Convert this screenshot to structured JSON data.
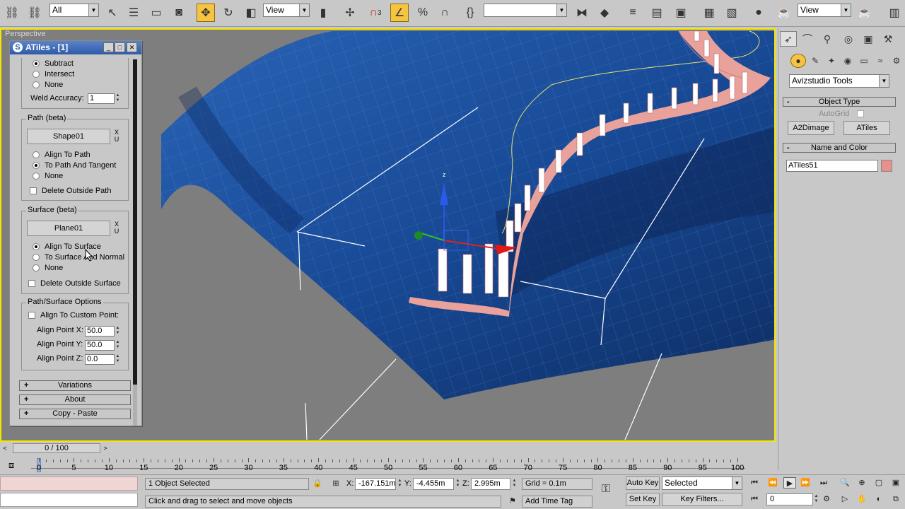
{
  "toolbar": {
    "filter_select": "All",
    "ref_coord_select": "View",
    "named_selection_select": "",
    "render_view_select": "View",
    "snaps_3_label": "3",
    "icons": [
      "link-icon",
      "unlink-icon",
      "bind-space-warp-icon",
      "select-icon",
      "select-by-name-icon",
      "rect-region-icon",
      "window-crossing-icon",
      "move-icon",
      "rotate-icon",
      "scale-icon",
      "pivot-icon",
      "manipulate-icon",
      "snap-icon",
      "angle-snap-icon",
      "percent-snap-icon",
      "spinner-snap-icon",
      "edit-named-sel-icon",
      "mirror-icon",
      "align-icon",
      "layer-icon",
      "curve-editor-icon",
      "schematic-icon",
      "material-editor-icon",
      "render-setup-icon",
      "render-icon",
      "teapot-icon"
    ]
  },
  "viewport": {
    "label": "Perspective",
    "gizmo": {
      "z_label": "z"
    }
  },
  "atiles_panel": {
    "title": "ATiles - [1]",
    "boolean": {
      "options": [
        "Subtract",
        "Intersect",
        "None"
      ],
      "selected": "Subtract",
      "weld_label": "Weld Accuracy:",
      "weld_value": "1"
    },
    "path": {
      "group_label": "Path (beta)",
      "shape_button": "Shape01",
      "x_label": "X",
      "u_label": "U",
      "options": [
        "Align To Path",
        "To Path And Tangent",
        "None"
      ],
      "selected": "To Path And Tangent",
      "delete_outside_label": "Delete Outside Path"
    },
    "surface": {
      "group_label": "Surface (beta)",
      "plane_button": "Plane01",
      "x_label": "X",
      "u_label": "U",
      "options": [
        "Align To Surface",
        "To Surface And Normal",
        "None"
      ],
      "selected": "Align To Surface",
      "delete_outside_label": "Delete Outside Surface"
    },
    "options": {
      "group_label": "Path/Surface Options",
      "custom_point_label": "Align To Custom Point:",
      "point_x_label": "Align Point X:",
      "point_x_value": "50.0",
      "point_y_label": "Align Point Y:",
      "point_y_value": "50.0",
      "point_z_label": "Align Point Z:",
      "point_z_value": "0.0"
    },
    "rollouts": [
      "Variations",
      "About",
      "Copy - Paste"
    ],
    "rollout_plus": "+"
  },
  "command_panel": {
    "tabs": [
      "create-icon",
      "modify-icon",
      "hierarchy-icon",
      "motion-icon",
      "display-icon",
      "utilities-icon"
    ],
    "subtabs": [
      "geometry-icon",
      "shapes-icon",
      "lights-icon",
      "cameras-icon",
      "helpers-icon",
      "spacewarps-icon",
      "systems-icon"
    ],
    "category_select": "Avizstudio Tools",
    "object_type": {
      "title": "Object Type",
      "minus": "-",
      "autogrid_label": "AutoGrid",
      "buttons": [
        "A2Dimage",
        "ATiles"
      ]
    },
    "name_and_color": {
      "title": "Name and Color",
      "minus": "-",
      "name_value": "ATiles51",
      "color": "#e9908e"
    }
  },
  "timeline": {
    "frame_label": "0 / 100",
    "ticks": [
      "0",
      "5",
      "10",
      "15",
      "20",
      "25",
      "30",
      "35",
      "40",
      "45",
      "50",
      "55",
      "60",
      "65",
      "70",
      "75",
      "80",
      "85",
      "90",
      "95",
      "100"
    ]
  },
  "status": {
    "selection_text": "1 Object Selected",
    "prompt_text": "Click and drag to select and move objects",
    "x_label": "X:",
    "x_value": "-167.151m",
    "y_label": "Y:",
    "y_value": "-4.455m",
    "z_label": "Z:",
    "z_value": "2.995m",
    "grid_text": "Grid = 0.1m",
    "add_time_tag": "Add Time Tag",
    "auto_key": "Auto Key",
    "set_key": "Set Key",
    "key_mode_select": "Selected",
    "key_filters": "Key Filters...",
    "frame_value": "0"
  },
  "colors": {
    "surface_blue": "#1a4f9c",
    "tiles_pink": "#e9a19c",
    "viewport_bg": "#7e7e7e",
    "active_border": "#f5e600",
    "active_tool": "#f5c542"
  }
}
